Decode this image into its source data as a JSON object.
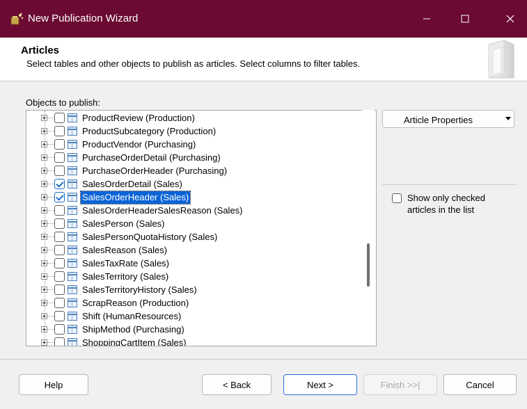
{
  "window": {
    "title": "New Publication Wizard"
  },
  "header": {
    "title": "Articles",
    "description": "Select tables and other objects to publish as articles. Select columns to filter tables."
  },
  "objects_label": "Objects to publish:",
  "tree_items": [
    {
      "label": "ProductReview (Production)",
      "checked": false,
      "selected": false
    },
    {
      "label": "ProductSubcategory (Production)",
      "checked": false,
      "selected": false
    },
    {
      "label": "ProductVendor (Purchasing)",
      "checked": false,
      "selected": false
    },
    {
      "label": "PurchaseOrderDetail (Purchasing)",
      "checked": false,
      "selected": false
    },
    {
      "label": "PurchaseOrderHeader (Purchasing)",
      "checked": false,
      "selected": false
    },
    {
      "label": "SalesOrderDetail (Sales)",
      "checked": true,
      "selected": false
    },
    {
      "label": "SalesOrderHeader (Sales)",
      "checked": true,
      "selected": true
    },
    {
      "label": "SalesOrderHeaderSalesReason (Sales)",
      "checked": false,
      "selected": false
    },
    {
      "label": "SalesPerson (Sales)",
      "checked": false,
      "selected": false
    },
    {
      "label": "SalesPersonQuotaHistory (Sales)",
      "checked": false,
      "selected": false
    },
    {
      "label": "SalesReason (Sales)",
      "checked": false,
      "selected": false
    },
    {
      "label": "SalesTaxRate (Sales)",
      "checked": false,
      "selected": false
    },
    {
      "label": "SalesTerritory (Sales)",
      "checked": false,
      "selected": false
    },
    {
      "label": "SalesTerritoryHistory (Sales)",
      "checked": false,
      "selected": false
    },
    {
      "label": "ScrapReason (Production)",
      "checked": false,
      "selected": false
    },
    {
      "label": "Shift (HumanResources)",
      "checked": false,
      "selected": false
    },
    {
      "label": "ShipMethod (Purchasing)",
      "checked": false,
      "selected": false
    },
    {
      "label": "ShoppingCartItem (Sales)",
      "checked": false,
      "selected": false
    }
  ],
  "article_properties": {
    "label": "Article Properties"
  },
  "show_only_checked": {
    "label": "Show only checked articles in the list",
    "checked": false
  },
  "buttons": {
    "help": "Help",
    "back": "< Back",
    "next": "Next >",
    "finish": "Finish >>|",
    "cancel": "Cancel"
  },
  "icons": {
    "app": "wizard-app-icon",
    "minimize": "minimize-icon",
    "maximize": "maximize-icon",
    "close": "close-icon",
    "header": "publication-icon",
    "table": "table-icon",
    "expand": "expand-icon",
    "dropdown": "chevron-down-icon"
  },
  "colors": {
    "titlebar": "#6b0a32",
    "selection": "#0a64d6",
    "checkbox_check": "#1f6fc5"
  }
}
